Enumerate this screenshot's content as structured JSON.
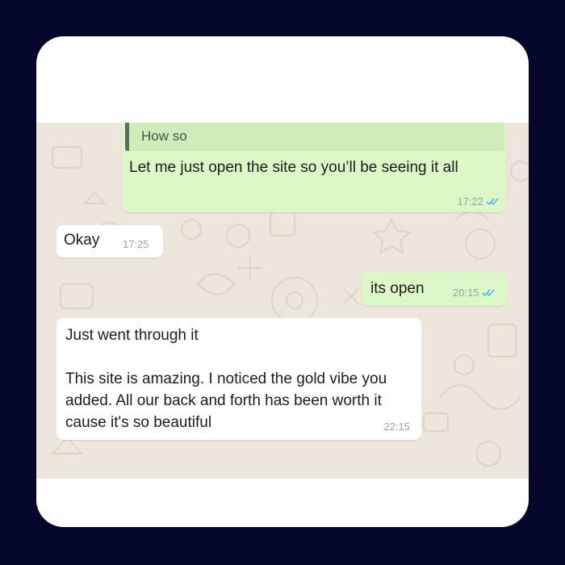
{
  "colors": {
    "frame_background": "#05072a",
    "card_background": "#ffffff",
    "chat_wallpaper": "#ede6dc",
    "outgoing_bubble": "#dcf8c6",
    "quote_background": "#d0ecba",
    "incoming_bubble": "#ffffff",
    "read_ticks": "#4fb6ec"
  },
  "messages": [
    {
      "direction": "outgoing",
      "quoted_text": "How so",
      "text": "Let me just open the site so you’ll be seeing it all",
      "time": "17:22",
      "status_icon": "double-check-read-icon"
    },
    {
      "direction": "incoming",
      "text": "Okay",
      "time": "17:25"
    },
    {
      "direction": "outgoing",
      "text": "its open",
      "time": "20:15",
      "status_icon": "double-check-read-icon"
    },
    {
      "direction": "incoming",
      "text": "Just went through it\n\nThis site is amazing. I noticed the gold vibe you added. All our back and forth has been worth it cause it's so beautiful",
      "time": "22:15"
    }
  ]
}
